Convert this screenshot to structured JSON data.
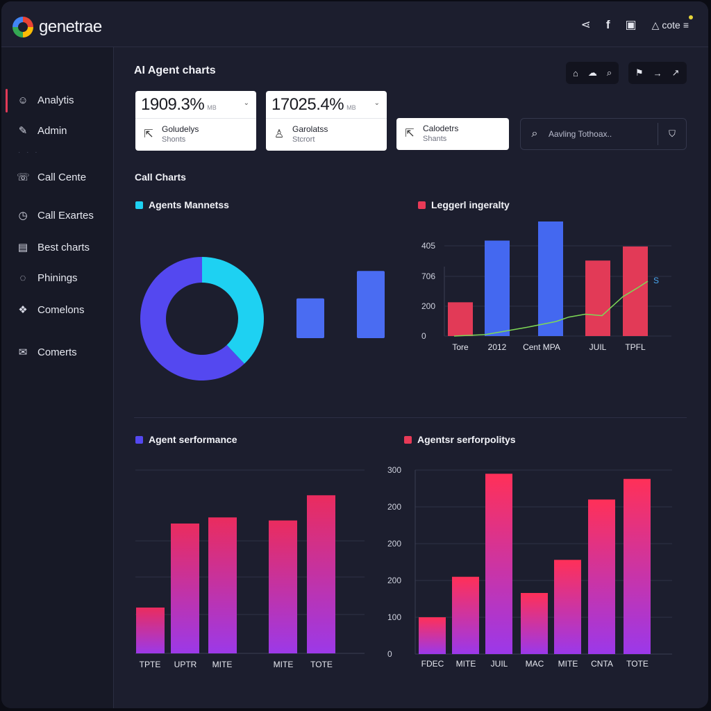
{
  "app": {
    "name": "genetrae"
  },
  "topbar": {
    "icons": [
      "share-icon",
      "facebook-icon",
      "calendar-icon"
    ],
    "user_label": "cote",
    "menu_icon": "menu-icon"
  },
  "sidebar": {
    "items": [
      {
        "label": "Analytis",
        "icon": "smiley-icon",
        "glyph": "☺",
        "active": true
      },
      {
        "label": "Admin",
        "icon": "pencil-icon",
        "glyph": "✎"
      },
      {
        "label": "Call Cente",
        "icon": "phone-icon",
        "glyph": "☏"
      },
      {
        "label": "Call Exartes",
        "icon": "clock-icon",
        "glyph": "◷"
      },
      {
        "label": "Best charts",
        "icon": "document-icon",
        "glyph": "▤"
      },
      {
        "label": "Phinings",
        "icon": "chat-icon",
        "glyph": "◌"
      },
      {
        "label": "Comelons",
        "icon": "puzzle-icon",
        "glyph": "❖"
      },
      {
        "label": "Comerts",
        "icon": "comment-icon",
        "glyph": "✉"
      }
    ]
  },
  "main": {
    "title": "AI Agent charts",
    "toolbar": {
      "group1": [
        "home-icon",
        "cloud-icon",
        "search-doc-icon"
      ],
      "group2": [
        "flag-icon",
        "arrow-right-icon",
        "expand-icon"
      ]
    },
    "stats": [
      {
        "value": "1909.3%",
        "unit": "MB",
        "line1": "Goludelys",
        "line2": "Shonts",
        "icon": "export-icon"
      },
      {
        "value": "17025.4%",
        "unit": "MB",
        "line1": "Garolatss",
        "line2": "Stcrort",
        "icon": "user-icon"
      },
      {
        "value": "",
        "unit": "",
        "line1": "Calodetrs",
        "line2": "Shants",
        "icon": "export-icon"
      }
    ],
    "search": {
      "placeholder": "Aavling Tothoax.."
    },
    "section_title": "Call Charts",
    "panel1_legend": "Agents Mannetss",
    "panel2_legend": "Leggerl ingeralty",
    "panel3_legend": "Agent serformance",
    "panel4_legend": "Agentsr serforpolitys"
  },
  "colors": {
    "cyan": "#1ed1f2",
    "indigo": "#5448f0",
    "blue": "#4a6cf2",
    "red": "#e83a57",
    "pink": "#ec2c60",
    "purple": "#9a3ae6",
    "green": "#7ed956"
  },
  "chart_data": [
    {
      "id": "agents-mannetss",
      "type": "pie",
      "title": "Agents Mannetss",
      "slices": [
        {
          "name": "",
          "value": 38,
          "color": "#1ed1f2"
        },
        {
          "name": "",
          "value": 62,
          "color": "#5448f0"
        }
      ],
      "bars": [
        52,
        88
      ],
      "bar_color": "#4a6cf2"
    },
    {
      "id": "leggerl-ingeralty",
      "type": "bar",
      "title": "Leggerl ingeralty",
      "categories": [
        "Tore",
        "2012",
        "Cent",
        "MPA",
        "JUIL",
        "TPFL"
      ],
      "tick_labels": [
        {
          "label": "Tore",
          "at": 0
        },
        {
          "label": "2012",
          "at": 1
        },
        {
          "label": "Cent  MPA",
          "at": 2
        },
        {
          "label": "JUIL",
          "at": 3
        },
        {
          "label": "TPFL",
          "at": 4
        }
      ],
      "bars": [
        {
          "pos": 0,
          "value": 115,
          "color": "#e23a57"
        },
        {
          "pos": 1,
          "value": 325,
          "color": "#4468f0"
        },
        {
          "pos": 2,
          "value": 390,
          "color": "#4468f0"
        },
        {
          "pos": 3,
          "value": 257,
          "color": "#e23a57"
        },
        {
          "pos": 4,
          "value": 305,
          "color": "#e23a57"
        }
      ],
      "line": {
        "color": "#7ed956",
        "points": [
          [
            -0.15,
            0
          ],
          [
            0.6,
            5
          ],
          [
            1.6,
            30
          ],
          [
            2.3,
            50
          ],
          [
            2.6,
            65
          ],
          [
            3.0,
            75
          ],
          [
            3.4,
            70
          ],
          [
            3.9,
            135
          ],
          [
            4.25,
            165
          ],
          [
            4.5,
            188
          ]
        ]
      },
      "line_end_label": "S",
      "ytick_labels": [
        "0",
        "200",
        "706",
        "405"
      ],
      "ytick_values": [
        0,
        100,
        200,
        300
      ],
      "ylim": [
        0,
        390
      ]
    },
    {
      "id": "agent-serformance",
      "type": "bar",
      "title": "Agent serformance",
      "categories": [
        "TPTE",
        "UPTR",
        "MITE",
        "",
        "MITE",
        "TOTE"
      ],
      "values": [
        60,
        170,
        178,
        0,
        174,
        207
      ],
      "ylim": [
        0,
        240
      ],
      "gradient": [
        "#ea2c5e",
        "#9c39e8"
      ]
    },
    {
      "id": "agentsr-serforpolitys",
      "type": "bar",
      "title": "Agentsr serforpolitys",
      "categories": [
        "FDEC",
        "MITE",
        "JUIL",
        "MAC",
        "MITE",
        "CNTA",
        "TOTE"
      ],
      "values": [
        50,
        105,
        245,
        83,
        128,
        210,
        238
      ],
      "ytick_labels": [
        "0",
        "100",
        "200",
        "200",
        "200",
        "300"
      ],
      "ytick_values": [
        0,
        50,
        100,
        150,
        200,
        250
      ],
      "ylim": [
        0,
        250
      ],
      "gradient": [
        "#ff3058",
        "#9b38ea"
      ]
    }
  ]
}
